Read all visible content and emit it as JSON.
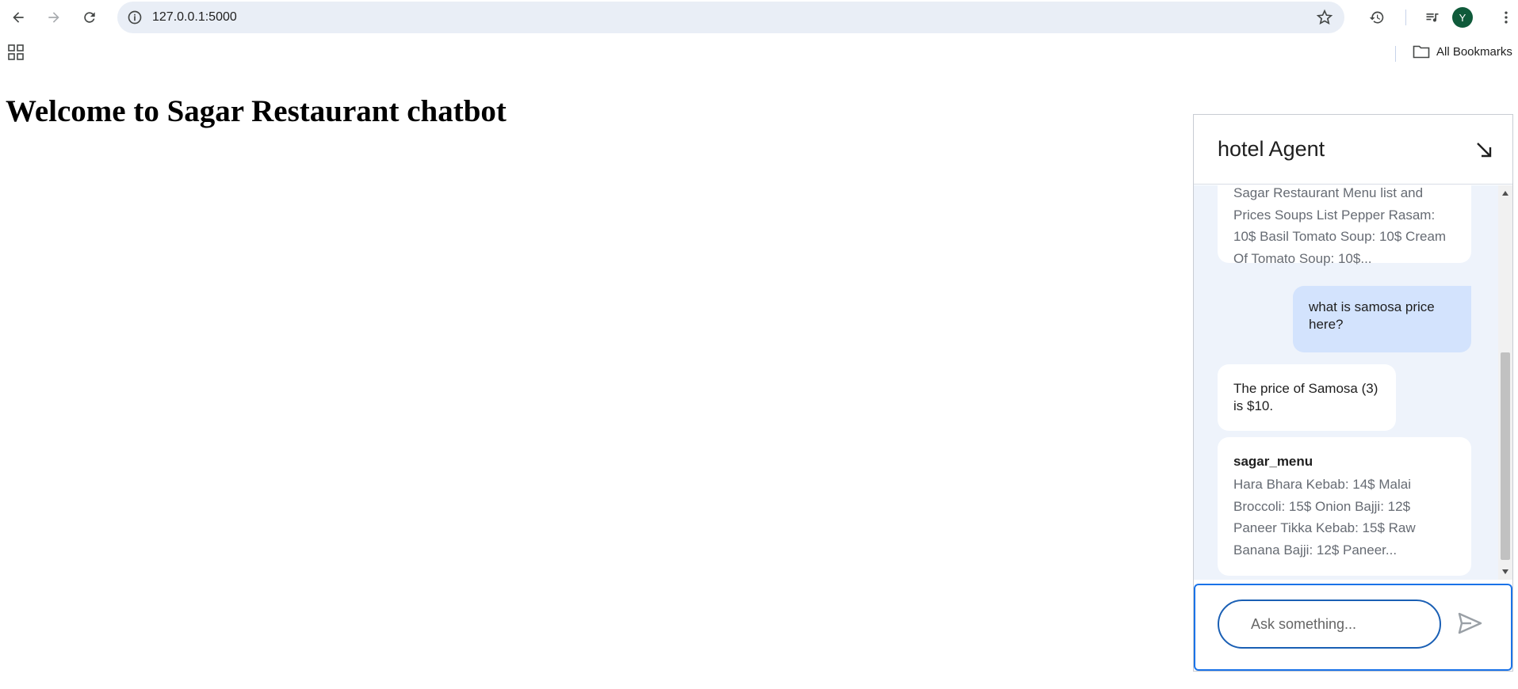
{
  "browser": {
    "url": "127.0.0.1:5000",
    "avatar_letter": "Y",
    "bookmarks_label": "All Bookmarks"
  },
  "page": {
    "title": "Welcome to Sagar Restaurant chatbot"
  },
  "chat": {
    "title": "hotel Agent",
    "messages": {
      "m1_lines": [
        "Sagar Restaurant Menu list and",
        "Prices Soups List Pepper Rasam:",
        "10$ Basil Tomato Soup: 10$ Cream",
        "Of Tomato Soup: 10$..."
      ],
      "m2_text": "what is samosa price here?",
      "m3_text": "The price of Samosa (3) is $10.",
      "m4_source": "sagar_menu",
      "m4_text": "Hara Bhara Kebab: 14$ Malai Broccoli: 15$ Onion Bajji: 12$ Paneer Tikka Kebab: 15$ Raw Banana Bajji: 12$ Paneer..."
    },
    "input_placeholder": "Ask something..."
  },
  "colors": {
    "accent": "#1a73e8",
    "user_bubble": "#d3e3fd",
    "chat_bg": "#eef3fb",
    "avatar_bg": "#0f5a3a"
  }
}
